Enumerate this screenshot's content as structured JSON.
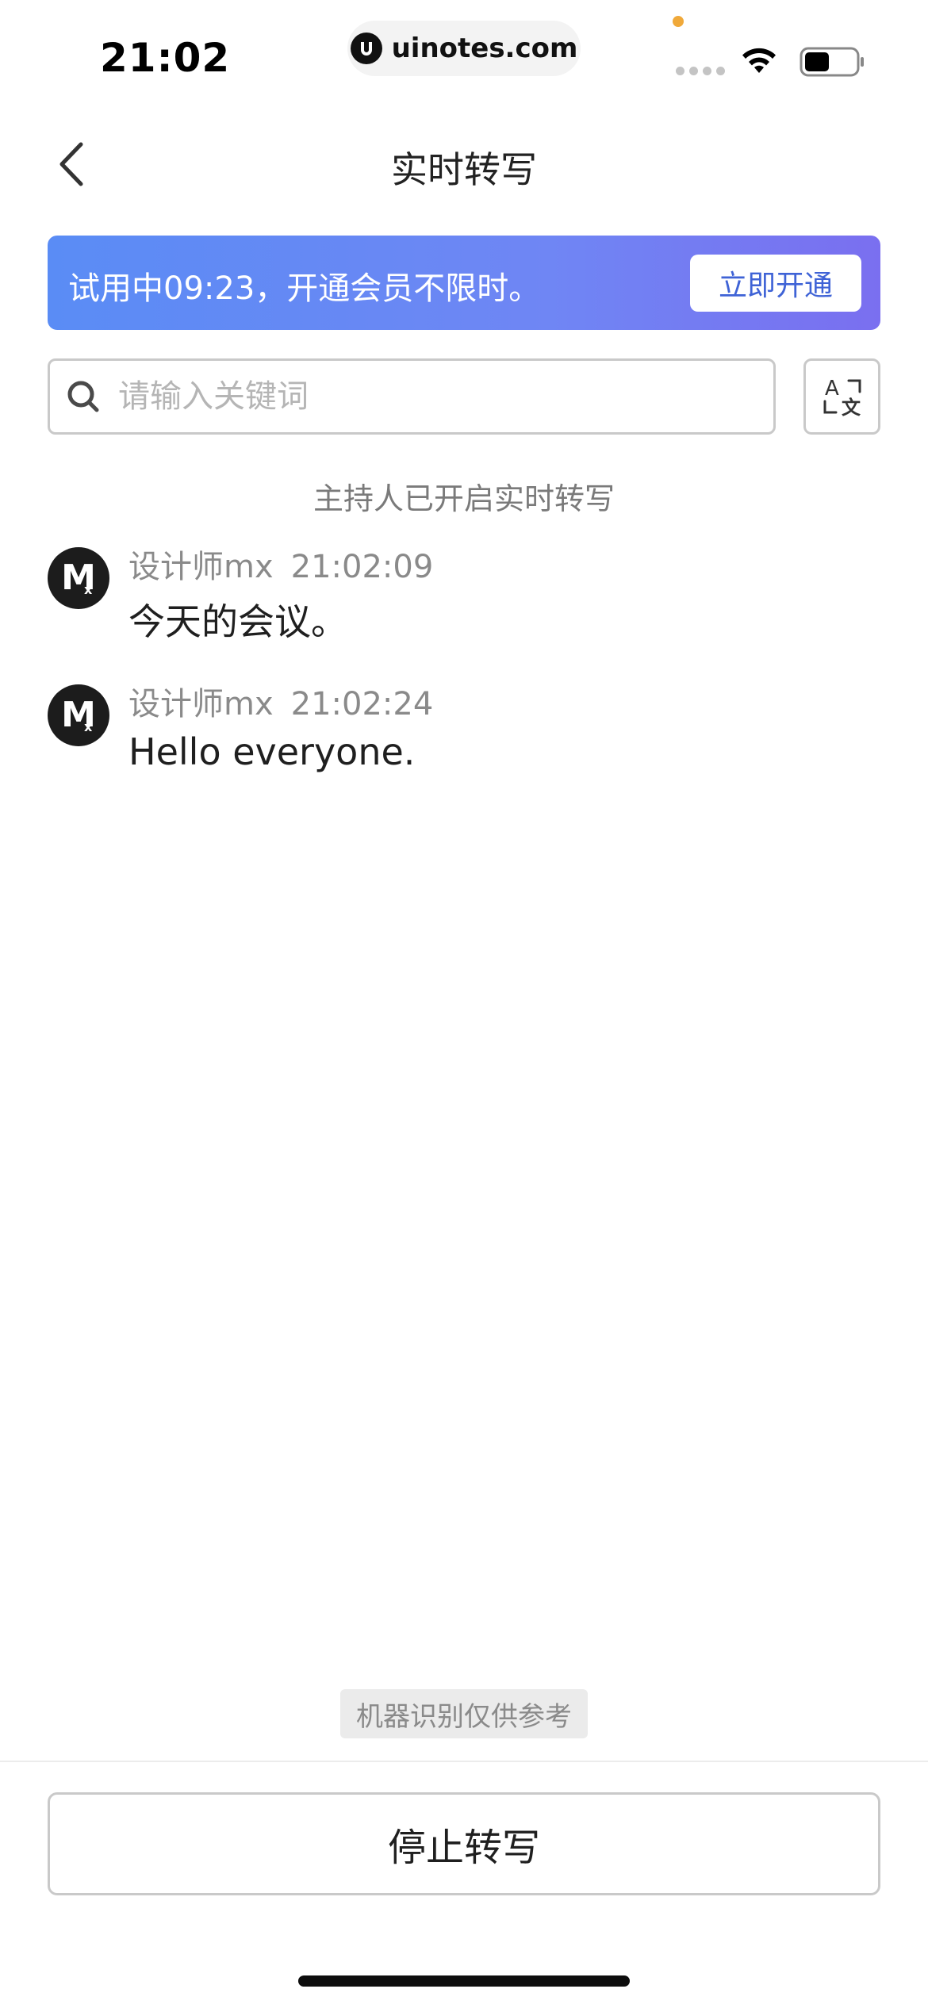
{
  "status_bar": {
    "time": "21:02",
    "url": "uinotes.com",
    "orange_dot_color": "#f0a93a",
    "signal_icon": "signal-dots-icon",
    "wifi_icon": "wifi-icon",
    "battery_icon": "battery-icon"
  },
  "header": {
    "title": "实时转写",
    "back_icon": "chevron-left-icon"
  },
  "trial_banner": {
    "text": "试用中09:23，开通会员不限时。",
    "button_label": "立即开通",
    "gradient_start": "#5a8cf5",
    "gradient_end": "#7a6ff0"
  },
  "search": {
    "placeholder": "请输入关键词",
    "value": "",
    "icon": "search-icon",
    "translate_icon": "translate-icon"
  },
  "system_notice": "主持人已开启实时转写",
  "messages": [
    {
      "speaker": "设计师mx",
      "time": "21:02:09",
      "text": "今天的会议。",
      "avatar_letter": "M",
      "avatar_sub": "x"
    },
    {
      "speaker": "设计师mx",
      "time": "21:02:24",
      "text": "Hello everyone.",
      "avatar_letter": "M",
      "avatar_sub": "x"
    }
  ],
  "disclaimer": "机器识别仅供参考",
  "stop_button_label": "停止转写",
  "accent_color": "#3f63d6"
}
